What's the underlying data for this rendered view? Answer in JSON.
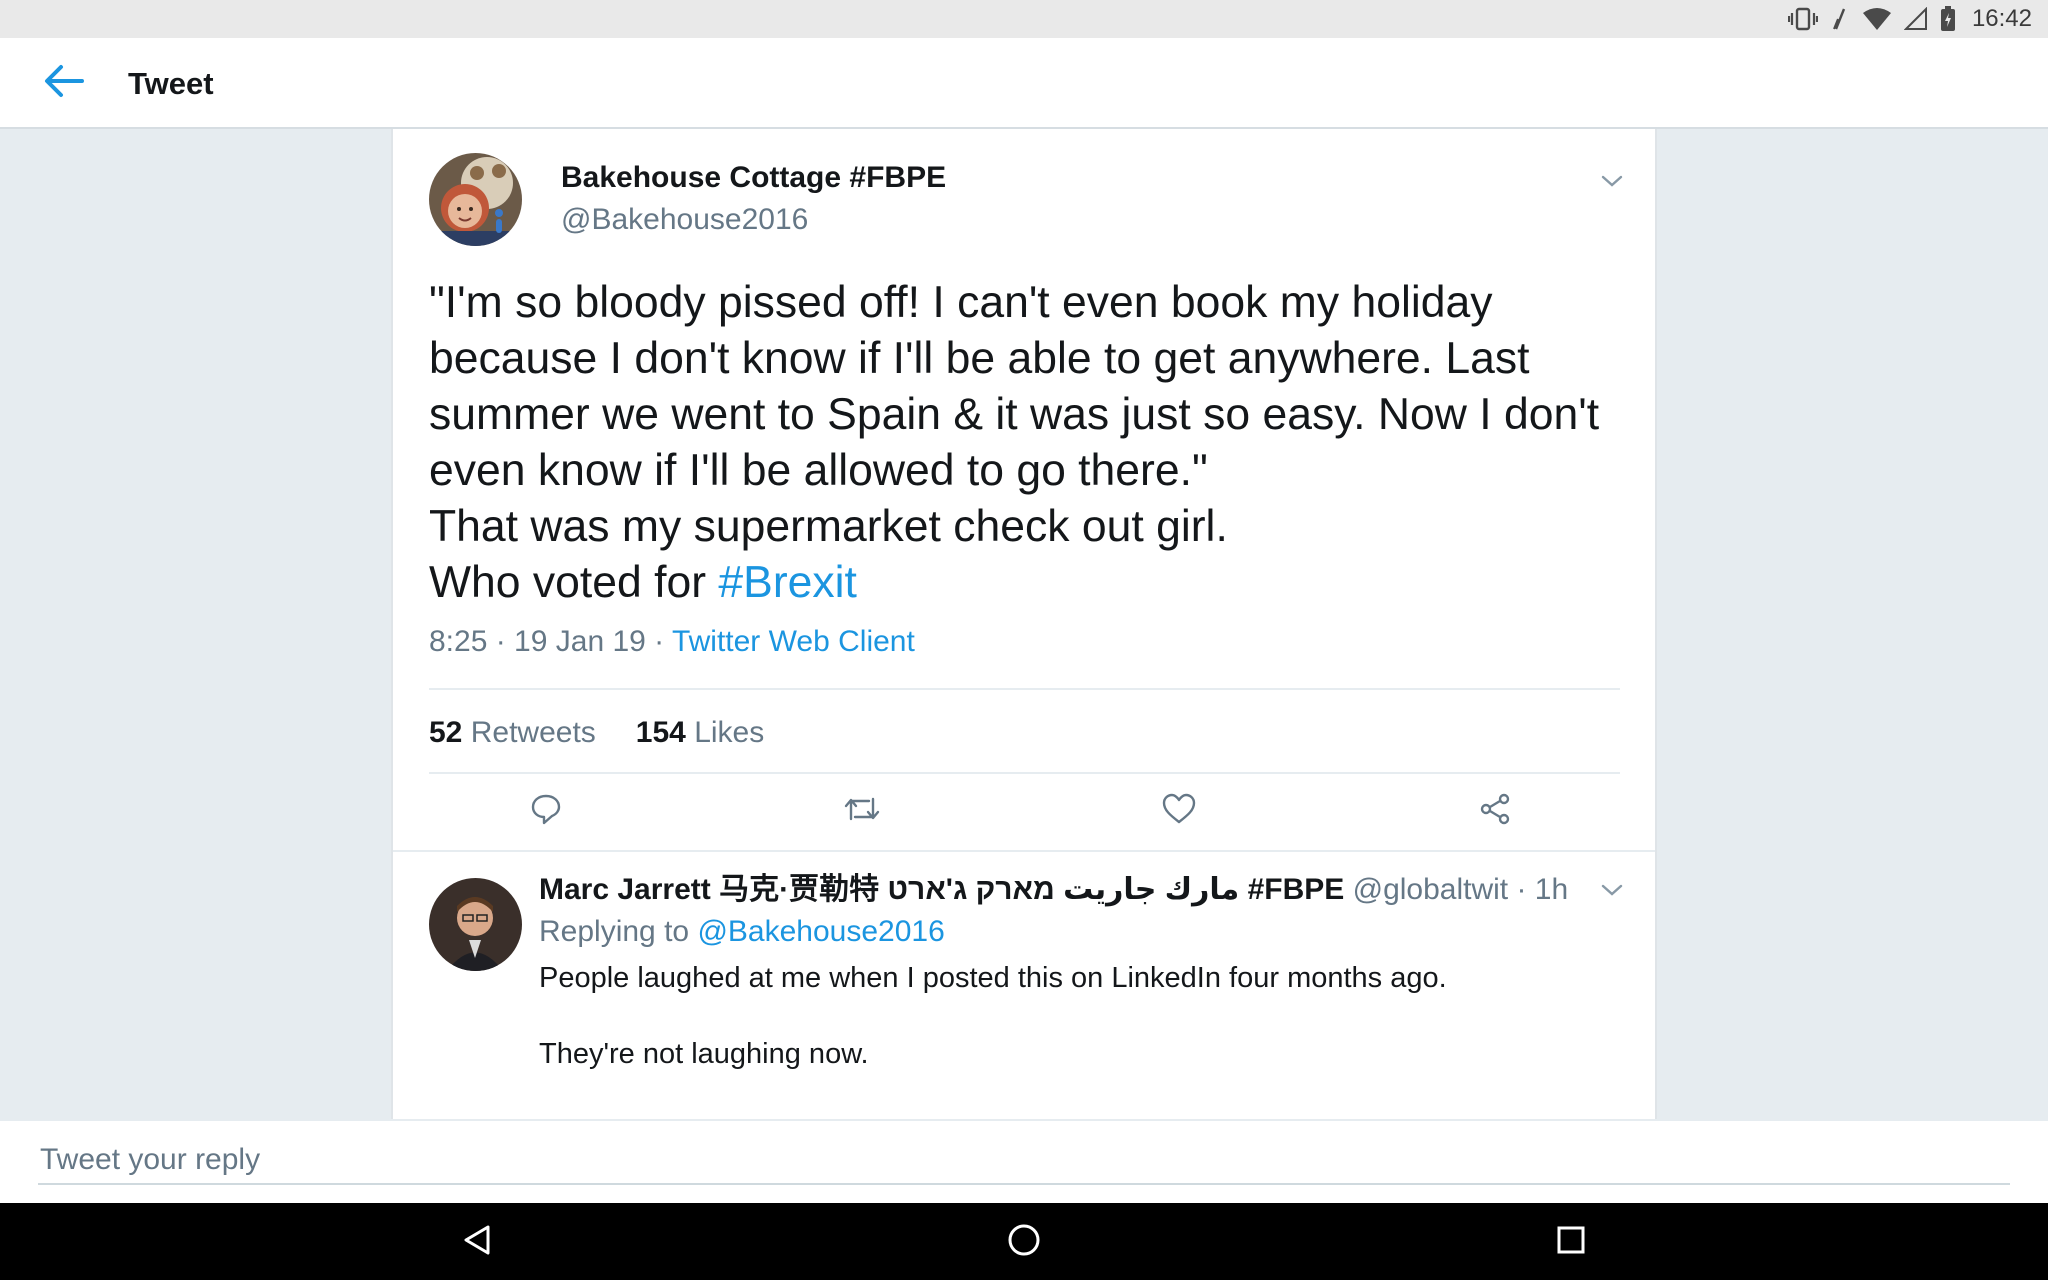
{
  "status_bar": {
    "time": "16:42",
    "icons": [
      "vibrate-icon",
      "no-sim-icon",
      "wifi-icon",
      "cell-signal-icon",
      "battery-charging-icon"
    ]
  },
  "app_bar": {
    "title": "Tweet",
    "back_icon": "arrow-left-icon"
  },
  "tweet": {
    "author_name": "Bakehouse Cottage #FBPE",
    "author_handle": "@Bakehouse2016",
    "text_lines": [
      "\"I'm so bloody pissed off! I can't even book my holiday",
      "because I don't know if I'll be able to get anywhere. Last",
      "summer we went to Spain & it was just so easy. Now I don't",
      "even know if I'll be allowed to go there.\"",
      "That was my supermarket check out girl."
    ],
    "last_line_prefix": "Who voted for ",
    "hashtag": "#Brexit",
    "timestamp": "8:25 · 19 Jan 19 · ",
    "source": "Twitter Web Client",
    "retweets_count": "52",
    "retweets_label": "Retweets",
    "likes_count": "154",
    "likes_label": "Likes",
    "actions": [
      "reply-icon",
      "retweet-icon",
      "like-icon",
      "share-icon"
    ]
  },
  "reply": {
    "name": "Marc Jarrett 马克·贾勒特 مارك جاريت מארק ג'ארט  #FBPE",
    "handle_time": " @globaltwit · 1h",
    "replying_prefix": "Replying to ",
    "replying_mention": "@Bakehouse2016",
    "text_lines": [
      "People laughed at me when I posted this on LinkedIn four months ago.",
      "They're not laughing now."
    ]
  },
  "compose": {
    "placeholder": "Tweet your reply"
  },
  "nav_bar": {
    "buttons": [
      "back-triangle-icon",
      "home-circle-icon",
      "recents-square-icon"
    ]
  },
  "colors": {
    "accent": "#1b95e0",
    "text_primary": "#14171a",
    "text_secondary": "#657786",
    "background": "#e6ecf0"
  }
}
